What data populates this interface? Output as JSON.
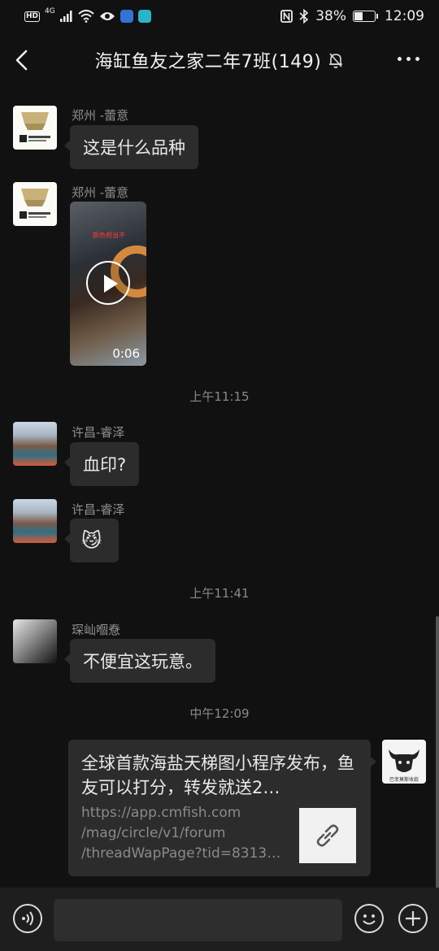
{
  "status_bar": {
    "hd": "HD",
    "network": "4G",
    "battery_percent": "38%",
    "battery_level": 0.38,
    "time": "12:09",
    "icons": [
      "hd-icon",
      "signal-icon",
      "wifi-icon",
      "eye-icon",
      "app-icon-blue",
      "app-icon-cyan",
      "nfc-icon",
      "bluetooth-icon",
      "battery-icon"
    ]
  },
  "header": {
    "title": "海缸鱼友之家二年7班(149)",
    "icons": [
      "back-icon",
      "mute-bell-icon",
      "more-icon"
    ]
  },
  "messages": [
    {
      "sender": "郑州 -蕾意",
      "text": "这是什么品种"
    },
    {
      "sender": "郑州 -蕾意",
      "video_caption": "颜色相当不",
      "video_duration": "0:06"
    },
    {
      "time": "上午11:15"
    },
    {
      "sender": "许昌-睿泽",
      "text": "血印?"
    },
    {
      "sender": "许昌-睿泽",
      "emoji": "😼"
    },
    {
      "time": "上午11:41"
    },
    {
      "sender": "琛屾嗰憃",
      "text": "不便宜这玩意。"
    },
    {
      "time": "中午12:09"
    },
    {
      "self": true,
      "link_title": "全球首款海盐天梯图小程序发布，鱼友可以打分，转发就送2…",
      "link_url": "https://app.cmfish.com /mag/circle/v1/forum /threadWapPage?tid=8313…",
      "avatar_label": "巴菲莫斯收款"
    }
  ],
  "lamp_avatar_brand": "蕾意灯饰",
  "bottom_bar": {
    "input_placeholder": "",
    "icons": [
      "voice-icon",
      "emoji-icon",
      "add-icon"
    ]
  },
  "colors": {
    "background": "#111111",
    "bubble": "#2c2c2c",
    "input_bar": "#1e1e1e",
    "secondary_text": "#8e8e8e"
  }
}
